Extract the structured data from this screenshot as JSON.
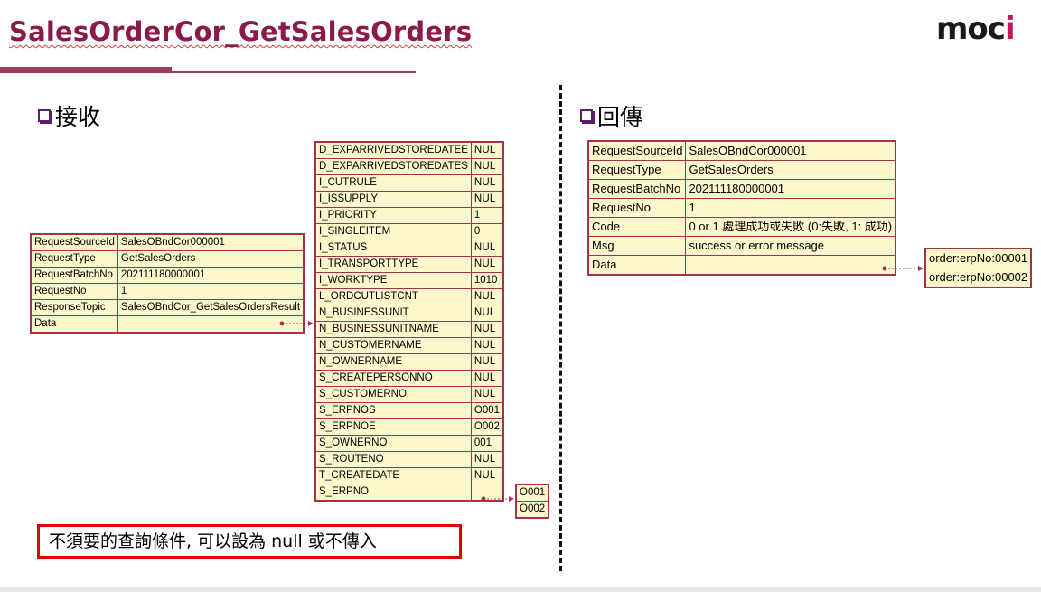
{
  "page": {
    "title": "SalesOrderCor_GetSalesOrders",
    "logo_main": "moc",
    "logo_accent": "i"
  },
  "sections": {
    "receive": "接收",
    "return": "回傳"
  },
  "request_table": [
    {
      "key": "RequestSourceId",
      "value": "SalesOBndCor000001"
    },
    {
      "key": "RequestType",
      "value": "GetSalesOrders"
    },
    {
      "key": "RequestBatchNo",
      "value": "202111180000001"
    },
    {
      "key": "RequestNo",
      "value": "1"
    },
    {
      "key": "ResponseTopic",
      "value": "SalesOBndCor_GetSalesOrdersResult"
    },
    {
      "key": "Data",
      "value": ""
    }
  ],
  "data_table": [
    {
      "key": "D_EXPARRIVEDSTOREDATEE",
      "value": "NUL"
    },
    {
      "key": "D_EXPARRIVEDSTOREDATES",
      "value": "NUL"
    },
    {
      "key": "I_CUTRULE",
      "value": "NUL"
    },
    {
      "key": "I_ISSUPPLY",
      "value": "NUL"
    },
    {
      "key": "I_PRIORITY",
      "value": "1"
    },
    {
      "key": "I_SINGLEITEM",
      "value": "0"
    },
    {
      "key": "I_STATUS",
      "value": "NUL"
    },
    {
      "key": "I_TRANSPORTTYPE",
      "value": "NUL"
    },
    {
      "key": "I_WORKTYPE",
      "value": "1010"
    },
    {
      "key": "L_ORDCUTLISTCNT",
      "value": "NUL"
    },
    {
      "key": "N_BUSINESSUNIT",
      "value": "NUL"
    },
    {
      "key": "N_BUSINESSUNITNAME",
      "value": "NUL"
    },
    {
      "key": "N_CUSTOMERNAME",
      "value": "NUL"
    },
    {
      "key": "N_OWNERNAME",
      "value": "NUL"
    },
    {
      "key": "S_CREATEPERSONNO",
      "value": "NUL"
    },
    {
      "key": "S_CUSTOMERNO",
      "value": "NUL"
    },
    {
      "key": "S_ERPNOS",
      "value": "O001"
    },
    {
      "key": "S_ERPNOE",
      "value": "O002"
    },
    {
      "key": "S_OWNERNO",
      "value": "001"
    },
    {
      "key": "S_ROUTENO",
      "value": "NUL"
    },
    {
      "key": "T_CREATEDATE",
      "value": "NUL"
    },
    {
      "key": "S_ERPNO",
      "value": ""
    }
  ],
  "erpno_list": [
    "O001",
    "O002"
  ],
  "response_table": [
    {
      "key": "RequestSourceId",
      "value": "SalesOBndCor000001"
    },
    {
      "key": "RequestType",
      "value": "GetSalesOrders"
    },
    {
      "key": "RequestBatchNo",
      "value": "202111180000001"
    },
    {
      "key": "RequestNo",
      "value": "1"
    },
    {
      "key": "Code",
      "value": "0 or 1 處理成功或失敗 (0:失敗, 1: 成功)"
    },
    {
      "key": "Msg",
      "value": "success or error message"
    },
    {
      "key": "Data",
      "value": ""
    }
  ],
  "order_list": [
    "order:erpNo:00001",
    "order:erpNo:00002"
  ],
  "note": "不須要的查詢條件, 可以設為 null 或不傳入",
  "colors": {
    "title": "#8b1a4a",
    "table_border": "#a6314f",
    "table_fill": "#fdf7cc",
    "note_border": "#e00000"
  }
}
